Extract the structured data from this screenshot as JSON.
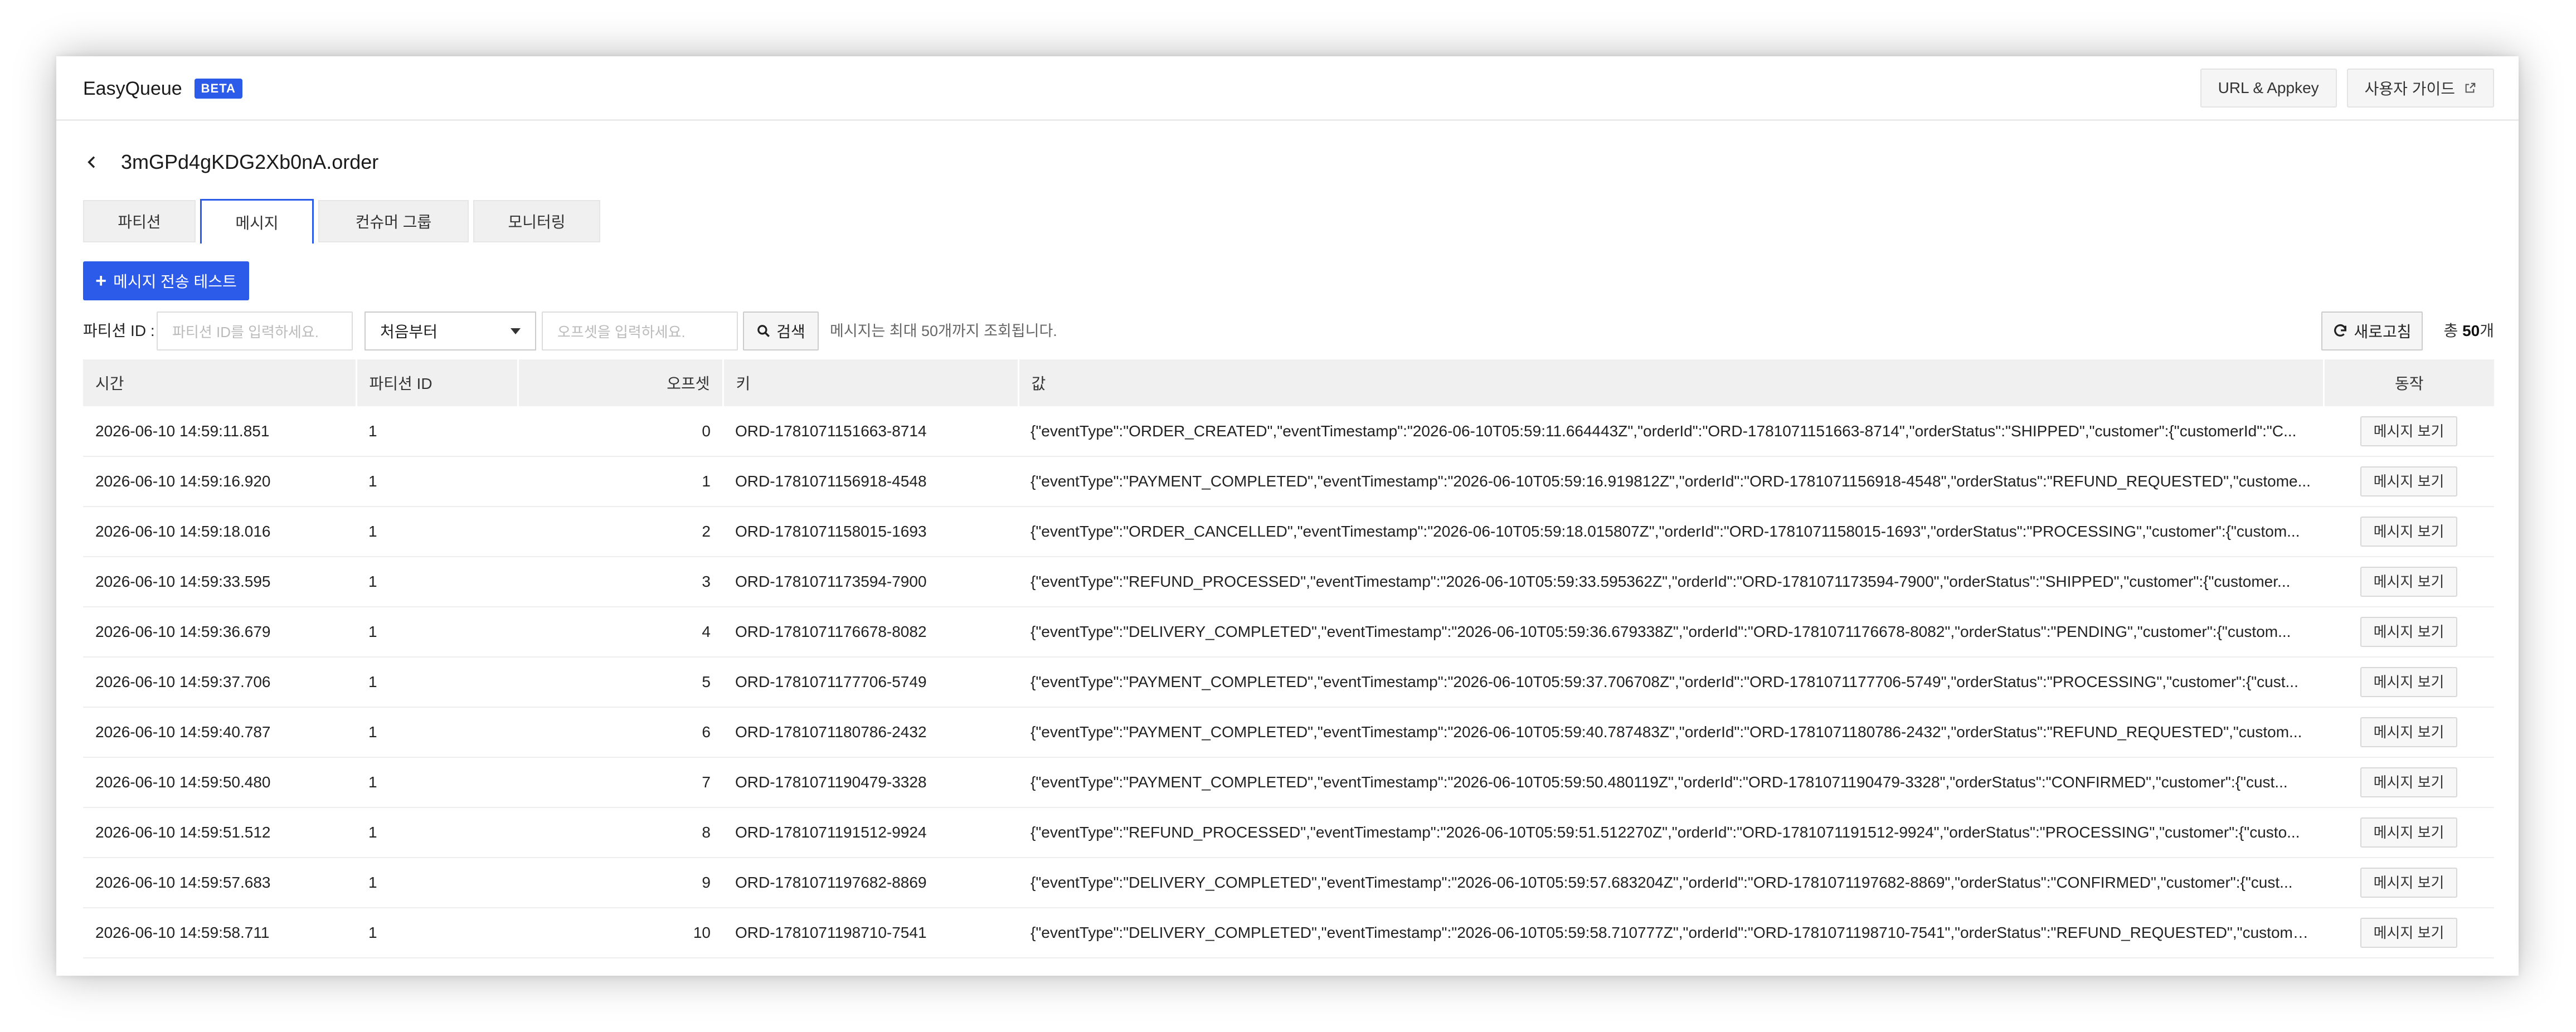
{
  "header": {
    "app_name": "EasyQueue",
    "badge": "BETA",
    "url_appkey_label": "URL & Appkey",
    "guide_label": "사용자 가이드"
  },
  "page": {
    "title": "3mGPd4gKDG2Xb0nA.order"
  },
  "tabs": [
    {
      "label": "파티션",
      "active": false
    },
    {
      "label": "메시지",
      "active": true
    },
    {
      "label": "컨슈머 그룹",
      "active": false
    },
    {
      "label": "모니터링",
      "active": false
    }
  ],
  "send_test_label": "메시지 전송 테스트",
  "filters": {
    "partition_label": "파티션 ID :",
    "partition_placeholder": "파티션 ID를 입력하세요.",
    "position_value": "처음부터",
    "offset_placeholder": "오프셋을 입력하세요.",
    "search_label": "검색",
    "note": "메시지는 최대 50개까지 조회됩니다.",
    "refresh_label": "새로고침",
    "total_prefix": "총 ",
    "total_count": "50",
    "total_suffix": "개"
  },
  "table": {
    "headers": {
      "time": "시간",
      "partition": "파티션 ID",
      "offset": "오프셋",
      "key": "키",
      "value": "값",
      "action": "동작"
    },
    "action_label": "메시지 보기",
    "rows": [
      {
        "time": "2026-06-10 14:59:11.851",
        "partition": "1",
        "offset": "0",
        "key": "ORD-1781071151663-8714",
        "value": "{\"eventType\":\"ORDER_CREATED\",\"eventTimestamp\":\"2026-06-10T05:59:11.664443Z\",\"orderId\":\"ORD-1781071151663-8714\",\"orderStatus\":\"SHIPPED\",\"customer\":{\"customerId\":\"C..."
      },
      {
        "time": "2026-06-10 14:59:16.920",
        "partition": "1",
        "offset": "1",
        "key": "ORD-1781071156918-4548",
        "value": "{\"eventType\":\"PAYMENT_COMPLETED\",\"eventTimestamp\":\"2026-06-10T05:59:16.919812Z\",\"orderId\":\"ORD-1781071156918-4548\",\"orderStatus\":\"REFUND_REQUESTED\",\"custome..."
      },
      {
        "time": "2026-06-10 14:59:18.016",
        "partition": "1",
        "offset": "2",
        "key": "ORD-1781071158015-1693",
        "value": "{\"eventType\":\"ORDER_CANCELLED\",\"eventTimestamp\":\"2026-06-10T05:59:18.015807Z\",\"orderId\":\"ORD-1781071158015-1693\",\"orderStatus\":\"PROCESSING\",\"customer\":{\"custom..."
      },
      {
        "time": "2026-06-10 14:59:33.595",
        "partition": "1",
        "offset": "3",
        "key": "ORD-1781071173594-7900",
        "value": "{\"eventType\":\"REFUND_PROCESSED\",\"eventTimestamp\":\"2026-06-10T05:59:33.595362Z\",\"orderId\":\"ORD-1781071173594-7900\",\"orderStatus\":\"SHIPPED\",\"customer\":{\"customer..."
      },
      {
        "time": "2026-06-10 14:59:36.679",
        "partition": "1",
        "offset": "4",
        "key": "ORD-1781071176678-8082",
        "value": "{\"eventType\":\"DELIVERY_COMPLETED\",\"eventTimestamp\":\"2026-06-10T05:59:36.679338Z\",\"orderId\":\"ORD-1781071176678-8082\",\"orderStatus\":\"PENDING\",\"customer\":{\"custom..."
      },
      {
        "time": "2026-06-10 14:59:37.706",
        "partition": "1",
        "offset": "5",
        "key": "ORD-1781071177706-5749",
        "value": "{\"eventType\":\"PAYMENT_COMPLETED\",\"eventTimestamp\":\"2026-06-10T05:59:37.706708Z\",\"orderId\":\"ORD-1781071177706-5749\",\"orderStatus\":\"PROCESSING\",\"customer\":{\"cust..."
      },
      {
        "time": "2026-06-10 14:59:40.787",
        "partition": "1",
        "offset": "6",
        "key": "ORD-1781071180786-2432",
        "value": "{\"eventType\":\"PAYMENT_COMPLETED\",\"eventTimestamp\":\"2026-06-10T05:59:40.787483Z\",\"orderId\":\"ORD-1781071180786-2432\",\"orderStatus\":\"REFUND_REQUESTED\",\"custom..."
      },
      {
        "time": "2026-06-10 14:59:50.480",
        "partition": "1",
        "offset": "7",
        "key": "ORD-1781071190479-3328",
        "value": "{\"eventType\":\"PAYMENT_COMPLETED\",\"eventTimestamp\":\"2026-06-10T05:59:50.480119Z\",\"orderId\":\"ORD-1781071190479-3328\",\"orderStatus\":\"CONFIRMED\",\"customer\":{\"cust..."
      },
      {
        "time": "2026-06-10 14:59:51.512",
        "partition": "1",
        "offset": "8",
        "key": "ORD-1781071191512-9924",
        "value": "{\"eventType\":\"REFUND_PROCESSED\",\"eventTimestamp\":\"2026-06-10T05:59:51.512270Z\",\"orderId\":\"ORD-1781071191512-9924\",\"orderStatus\":\"PROCESSING\",\"customer\":{\"custo..."
      },
      {
        "time": "2026-06-10 14:59:57.683",
        "partition": "1",
        "offset": "9",
        "key": "ORD-1781071197682-8869",
        "value": "{\"eventType\":\"DELIVERY_COMPLETED\",\"eventTimestamp\":\"2026-06-10T05:59:57.683204Z\",\"orderId\":\"ORD-1781071197682-8869\",\"orderStatus\":\"CONFIRMED\",\"customer\":{\"cust..."
      },
      {
        "time": "2026-06-10 14:59:58.711",
        "partition": "1",
        "offset": "10",
        "key": "ORD-1781071198710-7541",
        "value": "{\"eventType\":\"DELIVERY_COMPLETED\",\"eventTimestamp\":\"2026-06-10T05:59:58.710777Z\",\"orderId\":\"ORD-1781071198710-7541\",\"orderStatus\":\"REFUND_REQUESTED\",\"custome..."
      }
    ]
  },
  "icons": {
    "back": "chevron-left-icon",
    "external": "external-link-icon",
    "plus": "plus-icon",
    "search": "search-icon",
    "refresh": "refresh-icon",
    "caret": "caret-down-icon"
  },
  "colors": {
    "accent": "#2c5ae9",
    "header_bg": "#f0f0f0",
    "border": "#dddddd"
  }
}
